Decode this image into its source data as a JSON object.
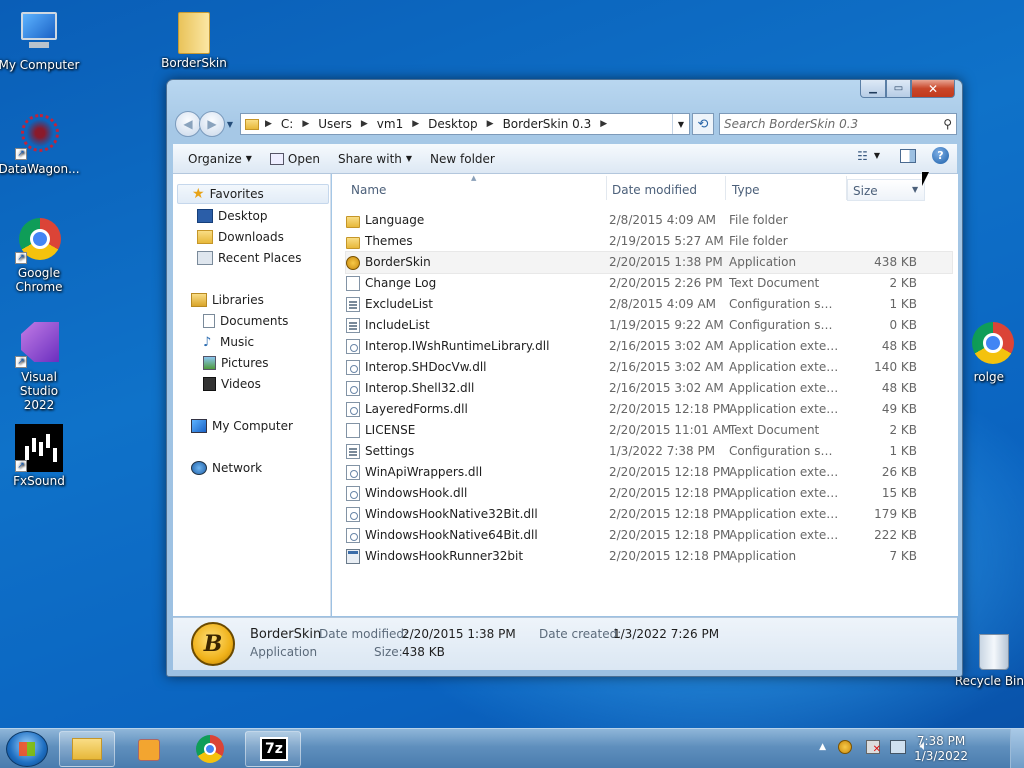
{
  "desktop": {
    "icons": [
      {
        "label": "My Computer",
        "icon": "monitor-icon"
      },
      {
        "label": "BorderSkin",
        "icon": "folder-icon"
      },
      {
        "label": "DataWagon...",
        "icon": "datawagon-icon"
      },
      {
        "label": "Google Chrome",
        "icon": "chrome-icon"
      },
      {
        "label": "Visual Studio 2022",
        "icon": "visual-studio-icon"
      },
      {
        "label": "FxSound",
        "icon": "fxsound-icon"
      },
      {
        "label": "rolge",
        "icon": "chrome-icon"
      },
      {
        "label": "Recycle Bin",
        "icon": "recycle-bin-icon"
      }
    ]
  },
  "window": {
    "address": {
      "crumbs": [
        "C:",
        "Users",
        "vm1",
        "Desktop",
        "BorderSkin 0.3"
      ]
    },
    "search": {
      "placeholder": "Search BorderSkin 0.3"
    },
    "toolbar": {
      "organize": "Organize",
      "open": "Open",
      "share_with": "Share with",
      "new_folder": "New folder"
    },
    "navigation": {
      "favorites": "Favorites",
      "favorite_items": [
        "Desktop",
        "Downloads",
        "Recent Places"
      ],
      "libraries": "Libraries",
      "library_items": [
        "Documents",
        "Music",
        "Pictures",
        "Videos"
      ],
      "my_computer": "My Computer",
      "network": "Network"
    },
    "columns": {
      "name": "Name",
      "date": "Date modified",
      "type": "Type",
      "size": "Size"
    },
    "files": [
      {
        "name": "Language",
        "date": "2/8/2015 4:09 AM",
        "type": "File folder",
        "size": "",
        "icon": "folder"
      },
      {
        "name": "Themes",
        "date": "2/19/2015 5:27 AM",
        "type": "File folder",
        "size": "",
        "icon": "folder"
      },
      {
        "name": "BorderSkin",
        "date": "2/20/2015 1:38 PM",
        "type": "Application",
        "size": "438 KB",
        "icon": "bskin"
      },
      {
        "name": "Change Log",
        "date": "2/20/2015 2:26 PM",
        "type": "Text Document",
        "size": "2 KB",
        "icon": "doc"
      },
      {
        "name": "ExcludeList",
        "date": "2/8/2015 4:09 AM",
        "type": "Configuration sett...",
        "size": "1 KB",
        "icon": "cfg"
      },
      {
        "name": "IncludeList",
        "date": "1/19/2015 9:22 AM",
        "type": "Configuration sett...",
        "size": "0 KB",
        "icon": "cfg"
      },
      {
        "name": "Interop.IWshRuntimeLibrary.dll",
        "date": "2/16/2015 3:02 AM",
        "type": "Application extens...",
        "size": "48 KB",
        "icon": "dll"
      },
      {
        "name": "Interop.SHDocVw.dll",
        "date": "2/16/2015 3:02 AM",
        "type": "Application extens...",
        "size": "140 KB",
        "icon": "dll"
      },
      {
        "name": "Interop.Shell32.dll",
        "date": "2/16/2015 3:02 AM",
        "type": "Application extens...",
        "size": "48 KB",
        "icon": "dll"
      },
      {
        "name": "LayeredForms.dll",
        "date": "2/20/2015 12:18 PM",
        "type": "Application extens...",
        "size": "49 KB",
        "icon": "dll"
      },
      {
        "name": "LICENSE",
        "date": "2/20/2015 11:01 AM",
        "type": "Text Document",
        "size": "2 KB",
        "icon": "doc"
      },
      {
        "name": "Settings",
        "date": "1/3/2022 7:38 PM",
        "type": "Configuration sett...",
        "size": "1 KB",
        "icon": "cfg"
      },
      {
        "name": "WinApiWrappers.dll",
        "date": "2/20/2015 12:18 PM",
        "type": "Application extens...",
        "size": "26 KB",
        "icon": "dll"
      },
      {
        "name": "WindowsHook.dll",
        "date": "2/20/2015 12:18 PM",
        "type": "Application extens...",
        "size": "15 KB",
        "icon": "dll"
      },
      {
        "name": "WindowsHookNative32Bit.dll",
        "date": "2/20/2015 12:18 PM",
        "type": "Application extens...",
        "size": "179 KB",
        "icon": "dll"
      },
      {
        "name": "WindowsHookNative64Bit.dll",
        "date": "2/20/2015 12:18 PM",
        "type": "Application extens...",
        "size": "222 KB",
        "icon": "dll"
      },
      {
        "name": "WindowsHookRunner32bit",
        "date": "2/20/2015 12:18 PM",
        "type": "Application",
        "size": "7 KB",
        "icon": "app"
      }
    ],
    "details": {
      "name": "BorderSkin",
      "type": "Application",
      "date_modified_label": "Date modified:",
      "date_modified": "2/20/2015 1:38 PM",
      "date_created_label": "Date created:",
      "date_created": "1/3/2022 7:26 PM",
      "size_label": "Size:",
      "size": "438 KB"
    }
  },
  "taskbar": {
    "items": [
      "explorer-icon",
      "media-player-icon",
      "chrome-icon",
      "7zip-icon"
    ],
    "sevenzip_label": "7z",
    "clock": {
      "time": "7:38 PM",
      "date": "1/3/2022"
    }
  }
}
